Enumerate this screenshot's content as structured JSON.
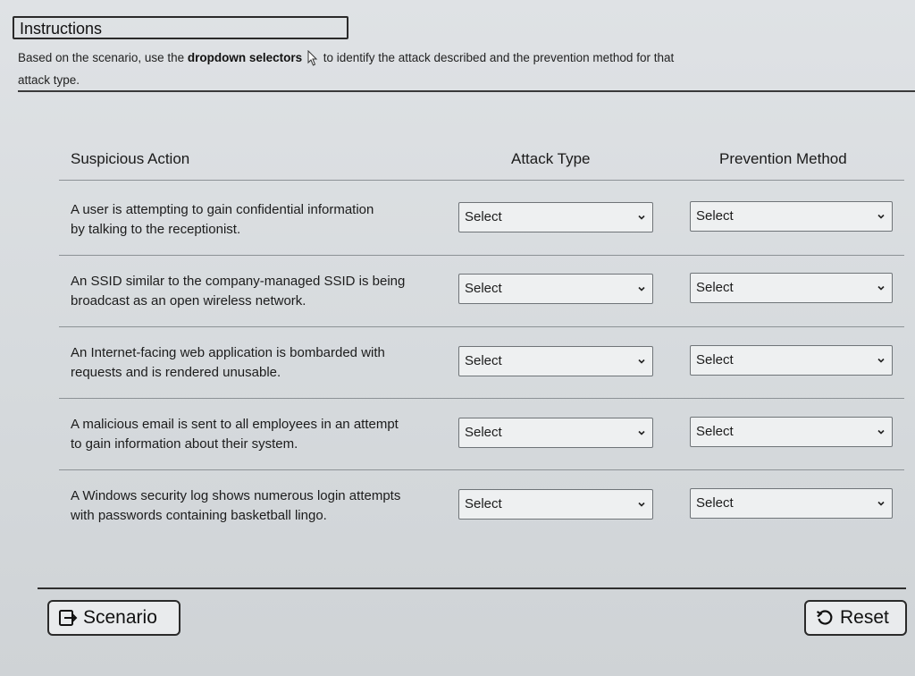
{
  "instructions": {
    "title": "Instructions",
    "text_before": "Based on the scenario, use the",
    "text_bold": "dropdown selectors",
    "text_after": "to identify the attack described and the prevention method for that",
    "text_line2": "attack type."
  },
  "table": {
    "headers": {
      "action": "Suspicious Action",
      "attack": "Attack Type",
      "prevention": "Prevention Method"
    },
    "rows": [
      {
        "line1": "A user is attempting to gain confidential information",
        "line2": "by talking to the receptionist.",
        "attack_value": "Select",
        "prevention_value": "Select"
      },
      {
        "line1": "An SSID similar to the company-managed SSID is being",
        "line2": "broadcast as an open wireless network.",
        "attack_value": "Select",
        "prevention_value": "Select"
      },
      {
        "line1": "An Internet-facing web application is bombarded with",
        "line2": "requests and is rendered unusable.",
        "attack_value": "Select",
        "prevention_value": "Select"
      },
      {
        "line1": "A malicious email is sent to all employees in an attempt",
        "line2": "to gain information about their system.",
        "attack_value": "Select",
        "prevention_value": "Select"
      },
      {
        "line1": "A Windows security log shows numerous login attempts",
        "line2": "with passwords containing basketball lingo.",
        "attack_value": "Select",
        "prevention_value": "Select"
      }
    ]
  },
  "footer": {
    "scenario_label": "Scenario",
    "reset_label": "Reset"
  },
  "icons": {
    "scenario": "exit-arrow-icon",
    "reset": "reset-icon",
    "dropdown": "chevron-down-icon",
    "cursor": "mouse-pointer-icon"
  }
}
